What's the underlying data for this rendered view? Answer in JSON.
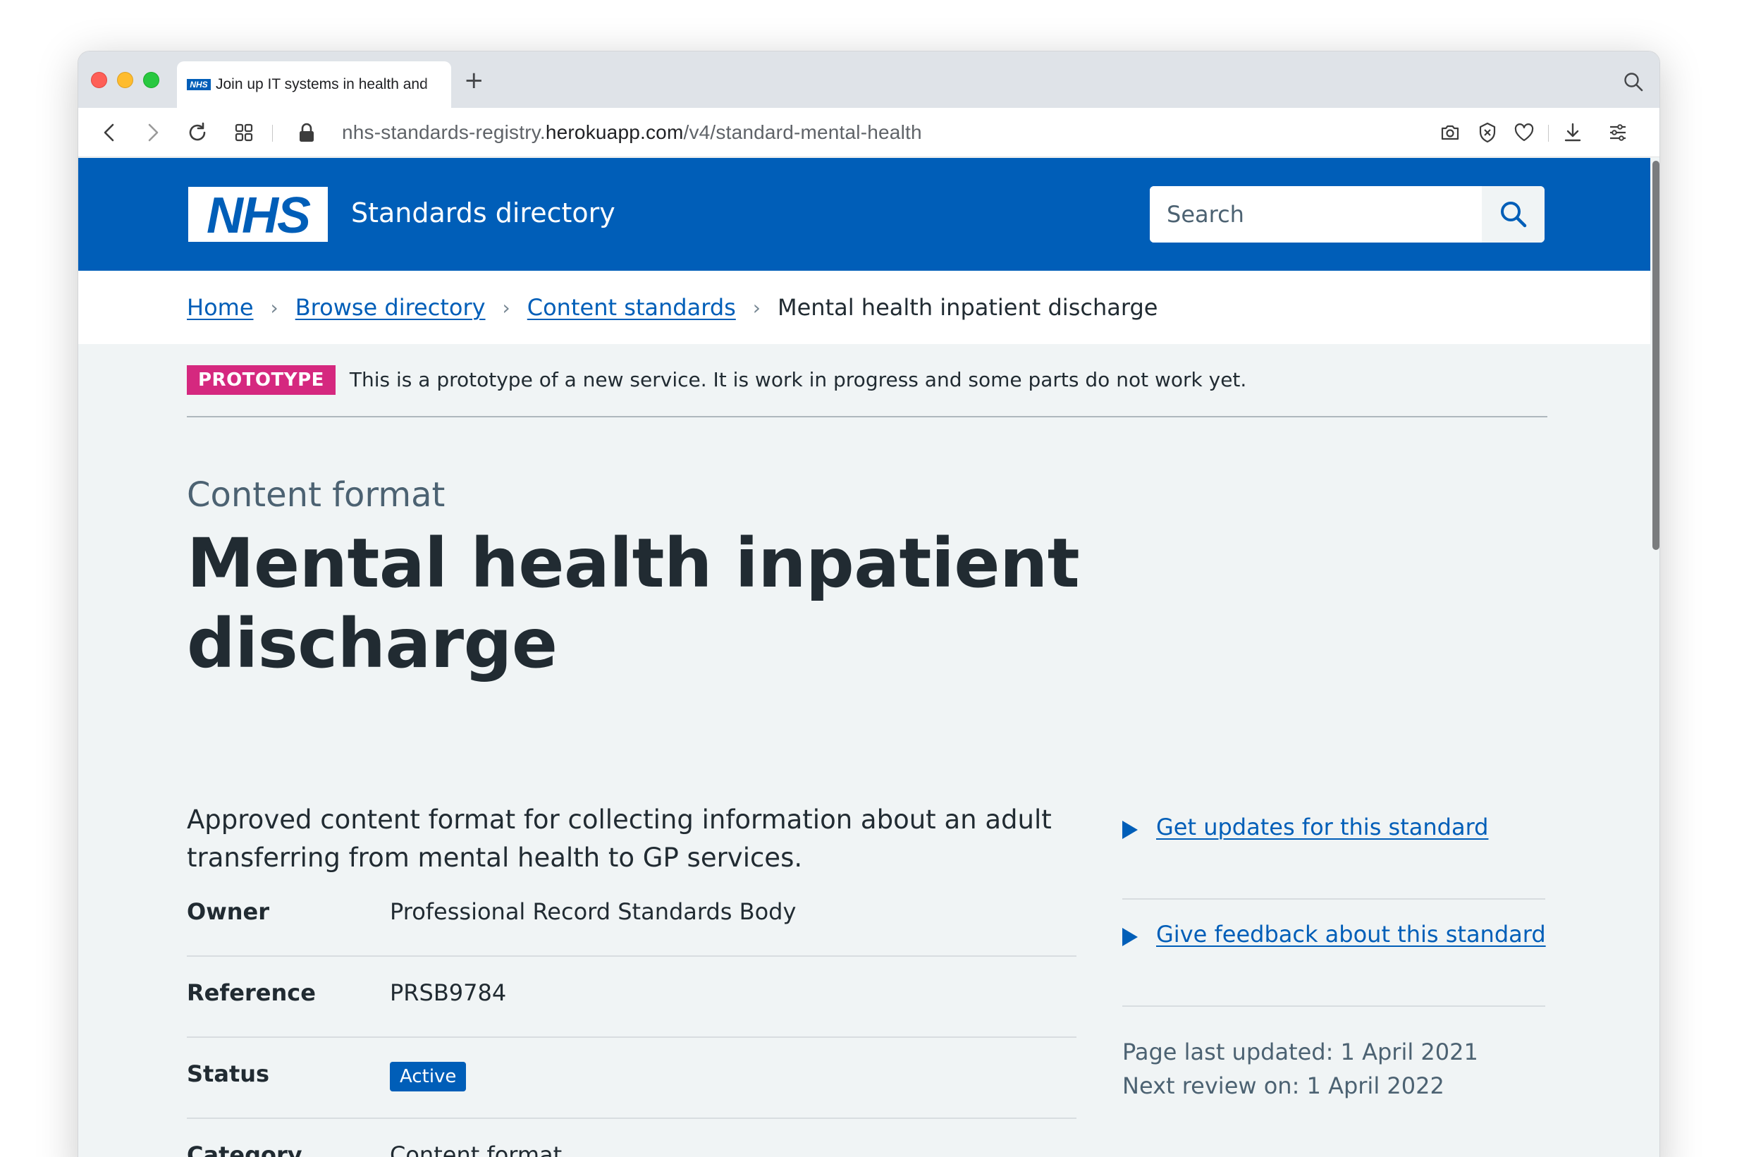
{
  "browser": {
    "tab_title": "Join up IT systems in health and",
    "tab_favicon_text": "NHS",
    "new_tab_symbol": "+",
    "url_prefix": "nhs-standards-registry.",
    "url_host": "herokuapp.com",
    "url_path": "/v4/standard-mental-health"
  },
  "header": {
    "logo_text": "NHS",
    "service_name": "Standards directory",
    "search_placeholder": "Search",
    "brand_color": "#005eb8"
  },
  "breadcrumb": {
    "items": [
      "Home",
      "Browse directory",
      "Content standards"
    ],
    "current": "Mental health inpatient discharge",
    "separator": "›"
  },
  "phase_banner": {
    "tag": "PROTOTYPE",
    "text": "This is a prototype of a new service. It is work in progress and some parts do not work yet.",
    "tag_color": "#d5287f"
  },
  "main": {
    "caption": "Content format",
    "title": "Mental health inpatient discharge",
    "lede": "Approved content format for collecting information about an adult transferring from mental health to GP services.",
    "summary": [
      {
        "key": "Owner",
        "value": "Professional Record Standards Body"
      },
      {
        "key": "Reference",
        "value": "PRSB9784"
      },
      {
        "key": "Status",
        "value": "Active"
      },
      {
        "key": "Category",
        "value": "Content format"
      }
    ]
  },
  "aside": {
    "links": [
      "Get updates for this standard",
      "Give feedback about this standard"
    ],
    "last_updated": "Page last updated: 1 April 2021",
    "next_review": "Next review on: 1 April 2022"
  },
  "icons": {
    "back": "chevron-left-icon",
    "forward": "chevron-right-icon",
    "reload": "reload-icon",
    "apps": "grid-icon",
    "lock": "lock-icon",
    "camera": "camera-icon",
    "shield": "shield-icon",
    "heart": "heart-icon",
    "download": "download-icon",
    "menu": "menu-icon",
    "search": "search-icon"
  }
}
